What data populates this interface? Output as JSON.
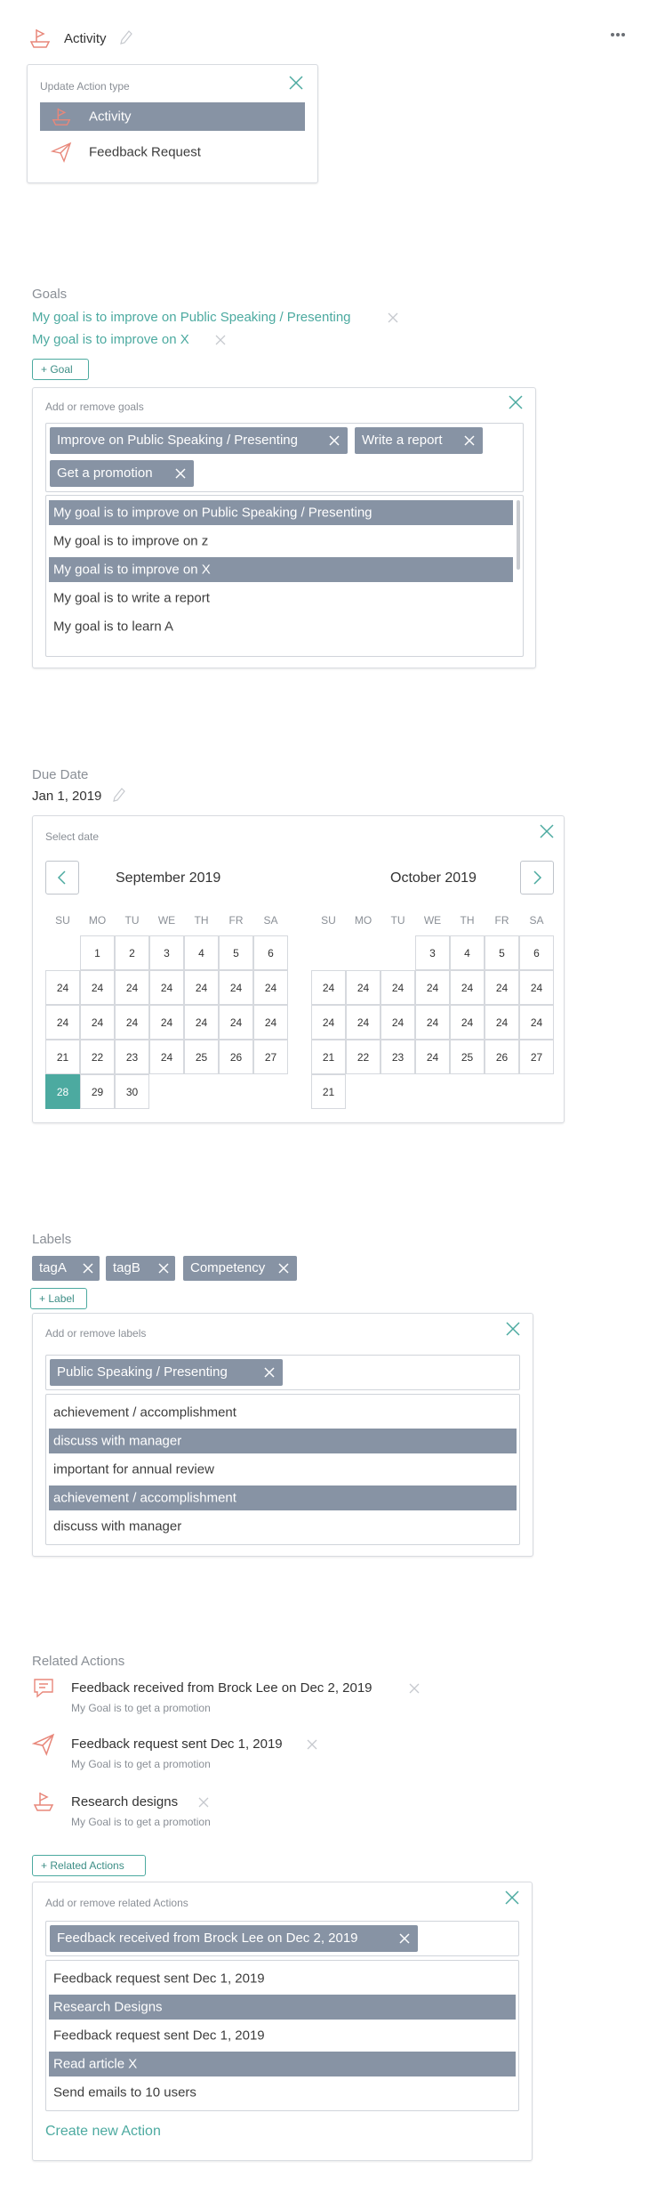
{
  "header": {
    "action_type": "Activity",
    "more_icon": "more-horizontal-icon"
  },
  "action_type_panel": {
    "title": "Update Action type",
    "options": [
      {
        "label": "Activity",
        "icon": "boat-icon",
        "selected": true
      },
      {
        "label": "Feedback Request",
        "icon": "paper-plane-icon",
        "selected": false
      }
    ]
  },
  "goals": {
    "label": "Goals",
    "items": [
      "My goal is to improve on Public Speaking / Presenting",
      "My goal is to improve on X"
    ],
    "add_button": "+ Goal",
    "panel": {
      "title": "Add or remove goals",
      "chips": [
        "Improve on Public Speaking / Presenting",
        "Write a report",
        "Get a promotion"
      ],
      "options": [
        {
          "label": "My goal is to improve on Public Speaking / Presenting",
          "selected": true
        },
        {
          "label": "My goal is to improve on z",
          "selected": false
        },
        {
          "label": "My goal is to improve on X",
          "selected": true
        },
        {
          "label": "My goal is to write a report",
          "selected": false
        },
        {
          "label": "My goal is to learn A",
          "selected": false
        }
      ]
    }
  },
  "due_date": {
    "label": "Due Date",
    "value": "Jan 1, 2019",
    "panel": {
      "title": "Select date",
      "weekdays": [
        "SU",
        "MO",
        "TU",
        "WE",
        "TH",
        "FR",
        "SA"
      ],
      "months": [
        {
          "title": "September 2019",
          "weeks": [
            [
              "",
              "1",
              "2",
              "3",
              "4",
              "5",
              "6"
            ],
            [
              "24",
              "24",
              "24",
              "24",
              "24",
              "24",
              "24"
            ],
            [
              "24",
              "24",
              "24",
              "24",
              "24",
              "24",
              "24"
            ],
            [
              "21",
              "22",
              "23",
              "24",
              "25",
              "26",
              "27"
            ],
            [
              "28",
              "29",
              "30",
              "",
              "",
              "",
              ""
            ]
          ],
          "selected_day": "28"
        },
        {
          "title": "October 2019",
          "weeks": [
            [
              "",
              "",
              "",
              "3",
              "4",
              "5",
              "6"
            ],
            [
              "24",
              "24",
              "24",
              "24",
              "24",
              "24",
              "24"
            ],
            [
              "24",
              "24",
              "24",
              "24",
              "24",
              "24",
              "24"
            ],
            [
              "21",
              "22",
              "23",
              "24",
              "25",
              "26",
              "27"
            ],
            [
              "21",
              "",
              "",
              "",
              "",
              "",
              ""
            ]
          ],
          "selected_day": ""
        }
      ]
    }
  },
  "labels": {
    "label": "Labels",
    "tags": [
      "tagA",
      "tagB",
      "Competency"
    ],
    "add_button": "+ Label",
    "panel": {
      "title": "Add or remove labels",
      "chips": [
        "Public Speaking / Presenting"
      ],
      "options": [
        {
          "label": "achievement / accomplishment",
          "selected": false
        },
        {
          "label": "discuss with manager",
          "selected": true
        },
        {
          "label": "important for annual review",
          "selected": false
        },
        {
          "label": "achievement / accomplishment",
          "selected": true
        },
        {
          "label": "discuss with manager",
          "selected": false
        }
      ]
    }
  },
  "related_actions": {
    "label": "Related Actions",
    "items": [
      {
        "title": "Feedback received from Brock Lee on  Dec 2, 2019",
        "subtitle": "My Goal is to get a promotion",
        "icon": "chat-bubble-icon"
      },
      {
        "title": "Feedback request sent Dec 1, 2019",
        "subtitle": "My Goal is to get a promotion",
        "icon": "paper-plane-icon"
      },
      {
        "title": "Research designs",
        "subtitle": "My Goal is to get a promotion",
        "icon": "boat-icon"
      }
    ],
    "add_button": "+ Related Actions",
    "panel": {
      "title": "Add or remove related Actions",
      "chips": [
        "Feedback received from Brock Lee on  Dec 2, 2019"
      ],
      "options": [
        {
          "label": "Feedback request sent Dec 1, 2019",
          "selected": false
        },
        {
          "label": "Research Designs",
          "selected": true
        },
        {
          "label": "Feedback request sent Dec 1, 2019",
          "selected": false
        },
        {
          "label": "Read article X",
          "selected": true
        },
        {
          "label": "Send emails to 10 users",
          "selected": false
        }
      ],
      "create_link": "Create new Action"
    }
  },
  "colors": {
    "accent": "#4caaa0",
    "selection": "#8793a4",
    "icon_salmon": "#e8877a"
  }
}
